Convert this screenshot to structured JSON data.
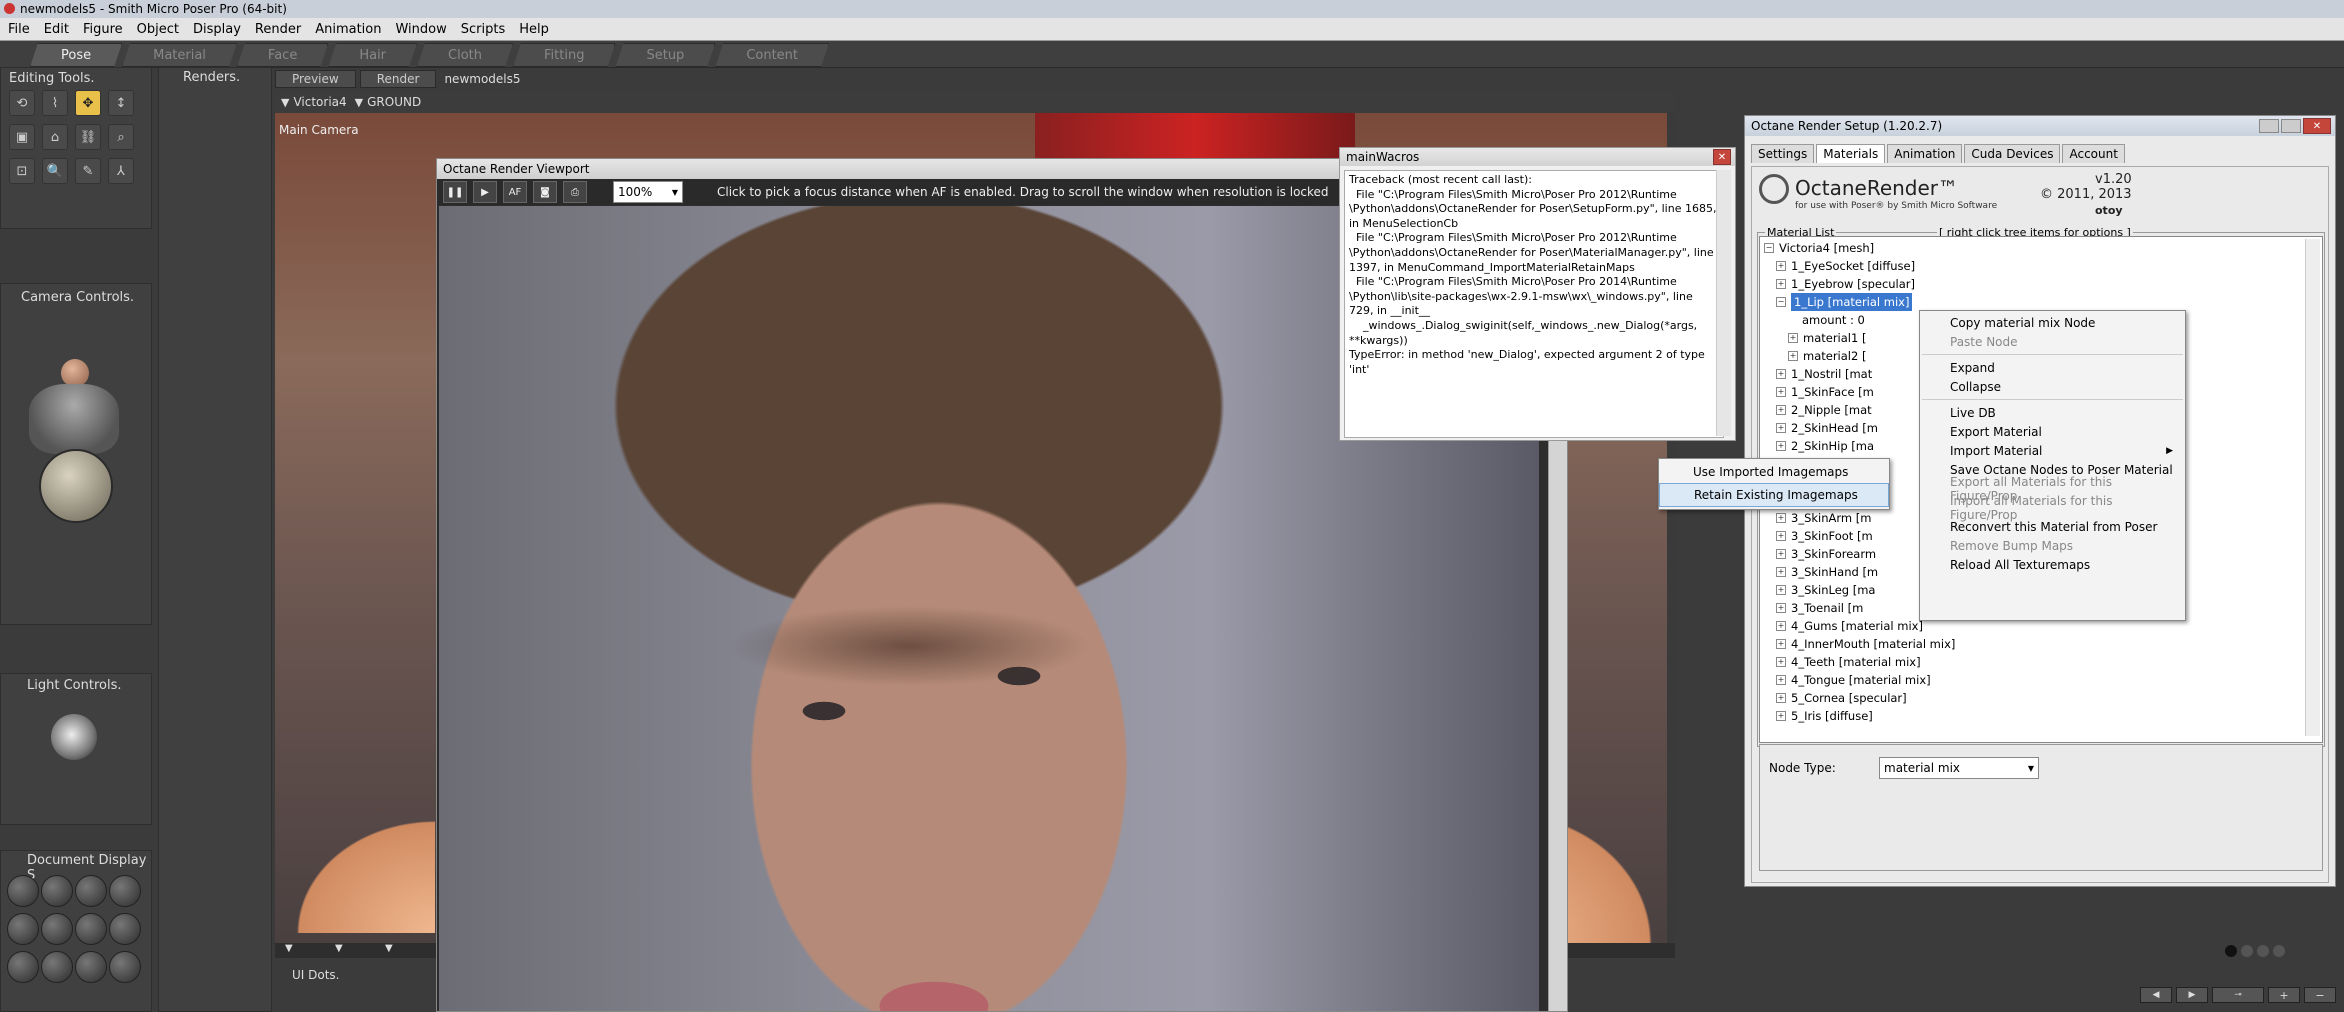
{
  "window": {
    "title": "newmodels5 - Smith Micro Poser Pro  (64-bit)"
  },
  "menubar": [
    "File",
    "Edit",
    "Figure",
    "Object",
    "Display",
    "Render",
    "Animation",
    "Window",
    "Scripts",
    "Help"
  ],
  "rooms": [
    {
      "label": "Pose",
      "active": true
    },
    {
      "label": "Material"
    },
    {
      "label": "Face"
    },
    {
      "label": "Hair"
    },
    {
      "label": "Cloth"
    },
    {
      "label": "Fitting"
    },
    {
      "label": "Setup"
    },
    {
      "label": "Content"
    }
  ],
  "left": {
    "editing_tools": "Editing Tools.",
    "camera_controls": "Camera Controls.",
    "light_controls": "Light Controls.",
    "document_display": "Document Display S",
    "renders": "Renders.",
    "ui_dots": "UI Dots."
  },
  "doc_tabs": {
    "preview": "Preview",
    "render": "Render",
    "doc": "newmodels5"
  },
  "viewport": {
    "figure": "Victoria4",
    "actor": "GROUND",
    "camera": "Main Camera"
  },
  "octane_viewport": {
    "title": "Octane Render Viewport",
    "zoom": "100%",
    "af_label": "AF",
    "hint": "Click to pick a focus distance when AF is enabled.  Drag to scroll the window when resolution is locked"
  },
  "wacros": {
    "title": "mainWacros",
    "text": "Traceback (most recent call last):\n  File \"C:\\Program Files\\Smith Micro\\Poser Pro 2012\\Runtime\n\\Python\\addons\\OctaneRender for Poser\\SetupForm.py\", line 1685,\nin MenuSelectionCb\n  File \"C:\\Program Files\\Smith Micro\\Poser Pro 2012\\Runtime\n\\Python\\addons\\OctaneRender for Poser\\MaterialManager.py\", line\n1397, in MenuCommand_ImportMaterialRetainMaps\n  File \"C:\\Program Files\\Smith Micro\\Poser Pro 2014\\Runtime\n\\Python\\lib\\site-packages\\wx-2.9.1-msw\\wx\\_windows.py\", line\n729, in __init__\n    _windows_.Dialog_swiginit(self,_windows_.new_Dialog(*args,\n**kwargs))\nTypeError: in method 'new_Dialog', expected argument 2 of type\n'int'"
  },
  "ors": {
    "title": "Octane Render Setup (1.20.2.7)",
    "tabs": [
      "Settings",
      "Materials",
      "Animation",
      "Cuda Devices",
      "Account"
    ],
    "logo": "OctaneRender™",
    "logo_sub": "for use with Poser® by Smith Micro Software",
    "version": "v1.20",
    "copyright": "© 2011, 2013",
    "brand": "otoy",
    "material_list_label": "Material List",
    "tree_hint": "[ right click tree items for options ]",
    "tree": [
      {
        "label": "Victoria4   [mesh]",
        "indent": 0,
        "box": "−"
      },
      {
        "label": "1_EyeSocket   [diffuse]",
        "indent": 1,
        "box": "+"
      },
      {
        "label": "1_Eyebrow   [specular]",
        "indent": 1,
        "box": "+"
      },
      {
        "label": "1_Lip   [material mix]",
        "indent": 1,
        "box": "−",
        "selected": true
      },
      {
        "label": "amount  :  0",
        "indent": 2
      },
      {
        "label": "material1   [",
        "indent": 2,
        "box": "+"
      },
      {
        "label": "material2   [",
        "indent": 2,
        "box": "+"
      },
      {
        "label": "1_Nostril   [mat",
        "indent": 1,
        "box": "+"
      },
      {
        "label": "1_SkinFace   [m",
        "indent": 1,
        "box": "+"
      },
      {
        "label": "2_Nipple   [mat",
        "indent": 1,
        "box": "+"
      },
      {
        "label": "2_SkinHead   [m",
        "indent": 1,
        "box": "+"
      },
      {
        "label": "2_SkinHip   [ma",
        "indent": 1,
        "box": "+"
      },
      {
        "label": "",
        "indent": 1
      },
      {
        "label": "",
        "indent": 1
      },
      {
        "label": "",
        "indent": 1
      },
      {
        "label": "3_SkinArm   [m",
        "indent": 1,
        "box": "+"
      },
      {
        "label": "3_SkinFoot   [m",
        "indent": 1,
        "box": "+"
      },
      {
        "label": "3_SkinForearm",
        "indent": 1,
        "box": "+"
      },
      {
        "label": "3_SkinHand   [m",
        "indent": 1,
        "box": "+"
      },
      {
        "label": "3_SkinLeg   [ma",
        "indent": 1,
        "box": "+"
      },
      {
        "label": "3_Toenail   [m",
        "indent": 1,
        "box": "+"
      },
      {
        "label": "4_Gums   [material mix]",
        "indent": 1,
        "box": "+"
      },
      {
        "label": "4_InnerMouth   [material mix]",
        "indent": 1,
        "box": "+"
      },
      {
        "label": "4_Teeth   [material mix]",
        "indent": 1,
        "box": "+"
      },
      {
        "label": "4_Tongue   [material mix]",
        "indent": 1,
        "box": "+"
      },
      {
        "label": "5_Cornea   [specular]",
        "indent": 1,
        "box": "+"
      },
      {
        "label": "5_Iris   [diffuse]",
        "indent": 1,
        "box": "+"
      }
    ],
    "node_type_label": "Node Type:",
    "node_type_value": "material mix"
  },
  "context_menu": [
    {
      "label": "Copy material mix Node"
    },
    {
      "label": "Paste Node",
      "disabled": true
    },
    {
      "sep": true
    },
    {
      "label": "Expand"
    },
    {
      "label": "Collapse"
    },
    {
      "sep": true
    },
    {
      "label": "Live DB"
    },
    {
      "label": "Export Material"
    },
    {
      "label": "Import Material",
      "submenu": true
    },
    {
      "label": "Save Octane Nodes to Poser Material"
    },
    {
      "label": "Export all Materials for this Figure/Prop",
      "disabled": true
    },
    {
      "label": "Import all Materials for this Figure/Prop",
      "disabled": true
    },
    {
      "label": "Reconvert this Material from Poser"
    },
    {
      "label": "Remove Bump Maps",
      "disabled": true
    },
    {
      "label": "Reload All Texturemaps"
    }
  ],
  "submenu": [
    {
      "label": "Use Imported Imagemaps"
    },
    {
      "label": "Retain Existing Imagemaps",
      "selected": true
    }
  ]
}
